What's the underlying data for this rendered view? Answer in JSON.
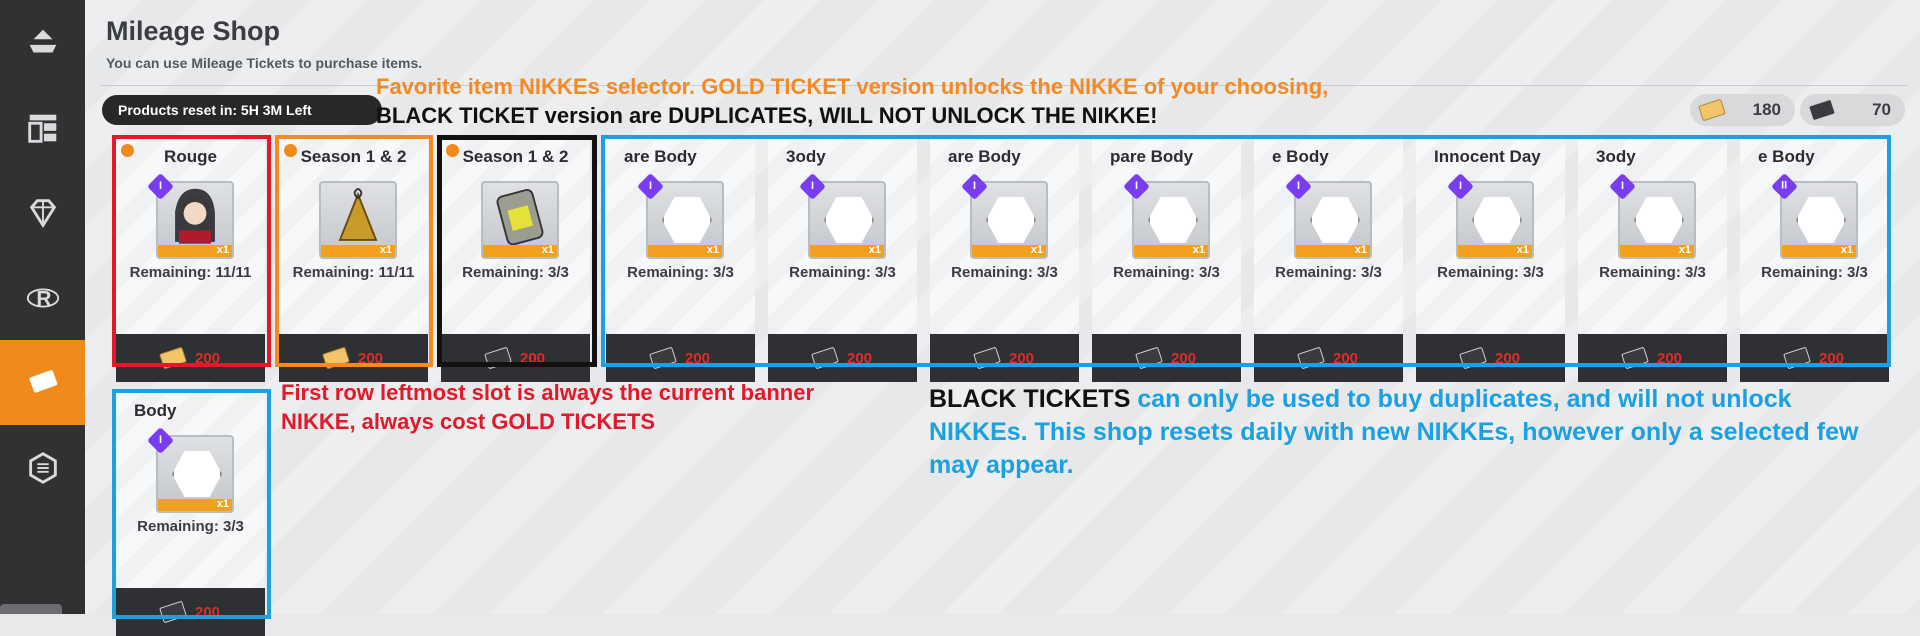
{
  "page": {
    "title": "Mileage Shop",
    "subtitle": "You can use Mileage Tickets to purchase items.",
    "reset_text": "Products reset in: 5H 3M Left"
  },
  "tickets": {
    "gold_count": "180",
    "black_count": "70"
  },
  "sidebar": [
    {
      "icon": "stack-icon",
      "active": false
    },
    {
      "icon": "layout-icon",
      "active": false
    },
    {
      "icon": "diamond-icon",
      "active": false
    },
    {
      "icon": "r-logo-icon",
      "active": false
    },
    {
      "icon": "ticket-icon",
      "active": true
    },
    {
      "icon": "hexagon-icon",
      "active": false
    }
  ],
  "annotations": {
    "top_orange": "Favorite item NIKKEs selector. GOLD TICKET version unlocks the NIKKE of your choosing,",
    "top_black": "BLACK TICKET version are DUPLICATES, WILL NOT UNLOCK THE NIKKE!",
    "red_note": "First row leftmost slot is always the current banner NIKKE, always cost GOLD TICKETS",
    "blue_lead": "BLACK TICKETS",
    "blue_rest": " can only be used to buy duplicates, and will not unlock NIKKEs. This shop resets daily with new NIKKEs, however only a selected few may appear."
  },
  "cards": [
    {
      "name": "Rouge",
      "remaining": "Remaining: 11/11",
      "price": "200",
      "ticket": "gold",
      "badge": "I",
      "qty": "x1"
    },
    {
      "name": "Season 1 & 2",
      "remaining": "Remaining: 11/11",
      "price": "200",
      "ticket": "gold",
      "badge": "",
      "qty": "x1"
    },
    {
      "name": "Season 1 & 2",
      "remaining": "Remaining: 3/3",
      "price": "200",
      "ticket": "black",
      "badge": "",
      "qty": "x1"
    },
    {
      "name": "are Body",
      "remaining": "Remaining: 3/3",
      "price": "200",
      "ticket": "black",
      "badge": "I",
      "qty": "x1"
    },
    {
      "name": "3ody",
      "remaining": "Remaining: 3/3",
      "price": "200",
      "ticket": "black",
      "badge": "I",
      "qty": "x1"
    },
    {
      "name": "are Body",
      "remaining": "Remaining: 3/3",
      "price": "200",
      "ticket": "black",
      "badge": "I",
      "qty": "x1"
    },
    {
      "name": "pare Body",
      "remaining": "Remaining: 3/3",
      "price": "200",
      "ticket": "black",
      "badge": "I",
      "qty": "x1"
    },
    {
      "name": "e Body",
      "remaining": "Remaining: 3/3",
      "price": "200",
      "ticket": "black",
      "badge": "I",
      "qty": "x1"
    },
    {
      "name": "Innocent Day",
      "remaining": "Remaining: 3/3",
      "price": "200",
      "ticket": "black",
      "badge": "I",
      "qty": "x1"
    },
    {
      "name": "3ody",
      "remaining": "Remaining: 3/3",
      "price": "200",
      "ticket": "black",
      "badge": "I",
      "qty": "x1"
    },
    {
      "name": "e Body",
      "remaining": "Remaining: 3/3",
      "price": "200",
      "ticket": "black",
      "badge": "II",
      "qty": "x1"
    },
    {
      "name": "Body",
      "remaining": "Remaining: 3/3",
      "price": "200",
      "ticket": "black",
      "badge": "I",
      "qty": "x1"
    }
  ],
  "colors": {
    "red_frame": "#e3192a",
    "orange_frame": "#f48a24",
    "black_frame": "#111111",
    "blue_frame": "#1ca0df",
    "accent": "#f08a1c"
  }
}
